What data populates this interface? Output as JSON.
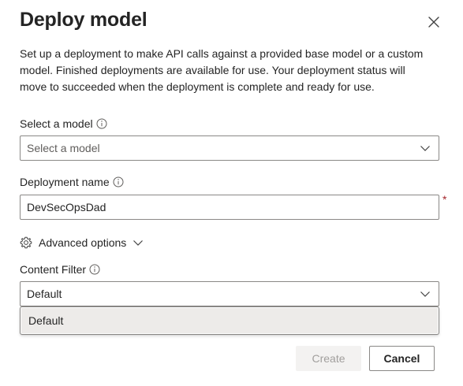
{
  "dialog": {
    "title": "Deploy model",
    "description": "Set up a deployment to make API calls against a provided base model or a custom model. Finished deployments are available for use. Your deployment status will move to succeeded when the deployment is complete and ready for use."
  },
  "model_field": {
    "label": "Select a model",
    "placeholder": "Select a model"
  },
  "deployment_name_field": {
    "label": "Deployment name",
    "value": "DevSecOpsDad",
    "required_mark": "*"
  },
  "advanced_options": {
    "label": "Advanced options"
  },
  "content_filter_field": {
    "label": "Content Filter",
    "value": "Default",
    "options": [
      "Default"
    ]
  },
  "footer": {
    "create_label": "Create",
    "cancel_label": "Cancel"
  },
  "colors": {
    "required": "#a4262c",
    "border": "#8a8886",
    "disabled_bg": "#f3f2f1",
    "disabled_text": "#a19f9d",
    "selected_option_bg": "#edebe9"
  },
  "icons": [
    "close-icon",
    "info-icon",
    "chevron-down-icon",
    "gear-icon"
  ]
}
